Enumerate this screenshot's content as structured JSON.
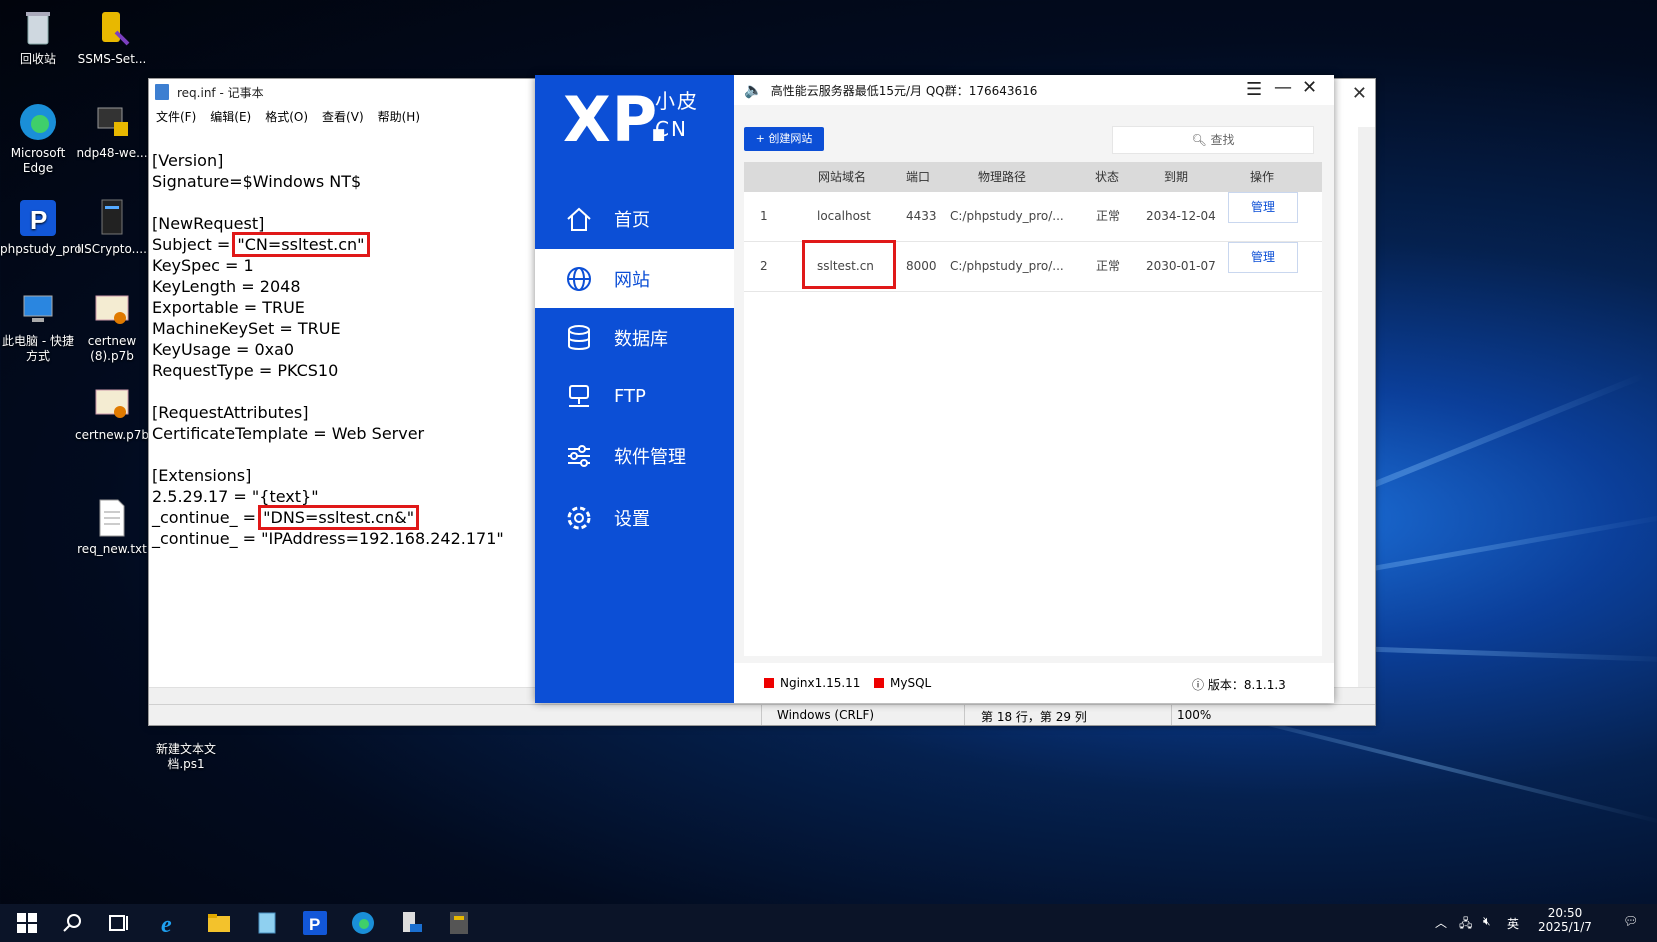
{
  "desktop": {
    "icons": [
      {
        "label": "回收站"
      },
      {
        "label": "SSMS-Set..."
      },
      {
        "label": "Microsoft Edge"
      },
      {
        "label": "ndp48-we..."
      },
      {
        "label": "phpstudy_pro"
      },
      {
        "label": "IISCrypto...."
      },
      {
        "label": "此电脑 - 快捷方式"
      },
      {
        "label": "certnew (8).p7b"
      },
      {
        "label": "certnew.p7b"
      },
      {
        "label": "req_new.txt"
      },
      {
        "label": "新建文本文档.ps1"
      }
    ]
  },
  "notepad": {
    "title": "req.inf - 记事本",
    "menu": [
      "文件(F)",
      "编辑(E)",
      "格式(O)",
      "查看(V)",
      "帮助(H)"
    ],
    "lines": {
      "l1": "[Version]",
      "l2": "Signature=$Windows NT$",
      "l3": "[NewRequest]",
      "l4a": "Subject = ",
      "l4b": "\"CN=ssltest.cn\"",
      "l5": "KeySpec = 1",
      "l6": "KeyLength = 2048",
      "l7": "Exportable = TRUE",
      "l8": "MachineKeySet = TRUE",
      "l9": "KeyUsage = 0xa0",
      "l10": "RequestType = PKCS10",
      "l11": "[RequestAttributes]",
      "l12": "CertificateTemplate = Web Server",
      "l13": "[Extensions]",
      "l14": "2.5.29.17 = \"{text}\"",
      "l15a": "_continue_ = ",
      "l15b": "\"DNS=ssltest.cn&\"",
      "l16": "_continue_ = \"IPAddress=192.168.242.171\""
    },
    "status": {
      "eol": "Windows (CRLF)",
      "position": "第 18 行，第 29 列",
      "zoom": "100%"
    }
  },
  "phpstudy": {
    "logo_big": "XP.",
    "logo_small_top": "小皮",
    "logo_small_bottom": "CN",
    "ad_text": "高性能云服务器最低15元/月  QQ群：176643616",
    "nav": [
      {
        "label": "首页",
        "icon": "home-icon"
      },
      {
        "label": "网站",
        "icon": "globe-icon"
      },
      {
        "label": "数据库",
        "icon": "database-icon"
      },
      {
        "label": "FTP",
        "icon": "ftp-icon"
      },
      {
        "label": "软件管理",
        "icon": "sliders-icon"
      },
      {
        "label": "设置",
        "icon": "gear-icon"
      }
    ],
    "active_nav": "网站",
    "create_label": "+ 创建网站",
    "search_placeholder": "查找",
    "columns": [
      "网站域名",
      "端口",
      "物理路径",
      "状态",
      "到期",
      "操作"
    ],
    "rows": [
      {
        "idx": "1",
        "domain": "localhost",
        "port": "4433",
        "path": "C:/phpstudy_pro/...",
        "status": "正常",
        "expire": "2034-12-04",
        "action": "管理"
      },
      {
        "idx": "2",
        "domain": "ssltest.cn",
        "port": "8000",
        "path": "C:/phpstudy_pro/...",
        "status": "正常",
        "expire": "2030-01-07",
        "action": "管理"
      }
    ],
    "footer": {
      "nginx": "Nginx1.15.11",
      "mysql": "MySQL",
      "version": "版本：8.1.1.3"
    },
    "accent": "#0c4fd6"
  },
  "taskbar": {
    "ime": "英",
    "time": "20:50",
    "date": "2025/1/7"
  }
}
